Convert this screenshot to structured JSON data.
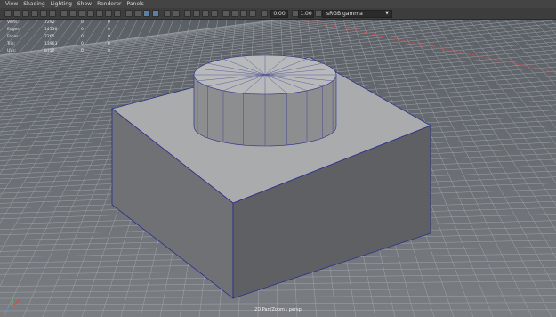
{
  "menu": {
    "items": [
      "View",
      "Shading",
      "Lighting",
      "Show",
      "Renderer",
      "Panels"
    ]
  },
  "toolbar": {
    "field_a": "0.00",
    "field_b": "1.00",
    "color_management": "sRGB gamma",
    "active_color": "#5b7fa6"
  },
  "hud": {
    "rows": [
      {
        "label": "Verts:",
        "v1": "7292",
        "v2": "0",
        "v3": "0"
      },
      {
        "label": "Edges:",
        "v1": "14536",
        "v2": "0",
        "v3": "0"
      },
      {
        "label": "Faces:",
        "v1": "7265",
        "v2": "0",
        "v3": "0"
      },
      {
        "label": "Tris:",
        "v1": "13963",
        "v2": "0",
        "v3": "0"
      },
      {
        "label": "UVs:",
        "v1": "8750",
        "v2": "0",
        "v3": "0"
      }
    ]
  },
  "viewport": {
    "camera_label": "2D Pan/Zoom : persp",
    "background_color": "#6e7277",
    "grid_color": "#a9adb2",
    "axis_color": "#d84848",
    "wire_color": "#2a2f8a"
  }
}
